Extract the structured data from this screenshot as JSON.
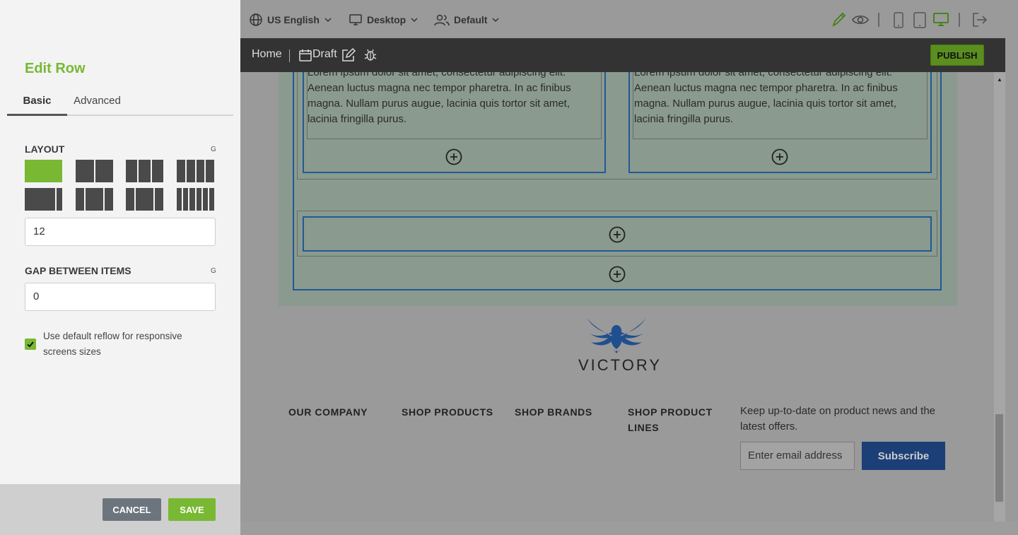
{
  "panel": {
    "title": "Edit Row",
    "tabs": [
      {
        "label": "Basic",
        "active": true
      },
      {
        "label": "Advanced",
        "active": false
      }
    ],
    "layout_label": "LAYOUT",
    "layout_g": "G",
    "layout_value": "12",
    "gap_label": "GAP BETWEEN ITEMS",
    "gap_g": "G",
    "gap_value": "0",
    "reflow_checked": true,
    "reflow_label": "Use default reflow for responsive screens sizes",
    "cancel_label": "CANCEL",
    "save_label": "SAVE",
    "accent_color": "#78b833"
  },
  "topbar": {
    "language": "US English",
    "device": "Desktop",
    "persona": "Default"
  },
  "bar2": {
    "home": "Home",
    "draft": "Draft",
    "publish": "PUBLISH"
  },
  "canvas": {
    "lorem": "Lorem ipsum dolor sit amet, consectetur adipiscing elit. Aenean luctus magna nec tempor pharetra. In ac finibus magna. Nullam purus augue, lacinia quis tortor sit amet, lacinia fringilla purus."
  },
  "footer": {
    "logo_text": "VICTORY",
    "columns": [
      "OUR COMPANY",
      "SHOP PRODUCTS",
      "SHOP BRANDS",
      "SHOP PRODUCT LINES"
    ],
    "newsletter_text": "Keep up-to-date on product news and the latest offers.",
    "email_placeholder": "Enter email address",
    "subscribe_label": "Subscribe"
  }
}
